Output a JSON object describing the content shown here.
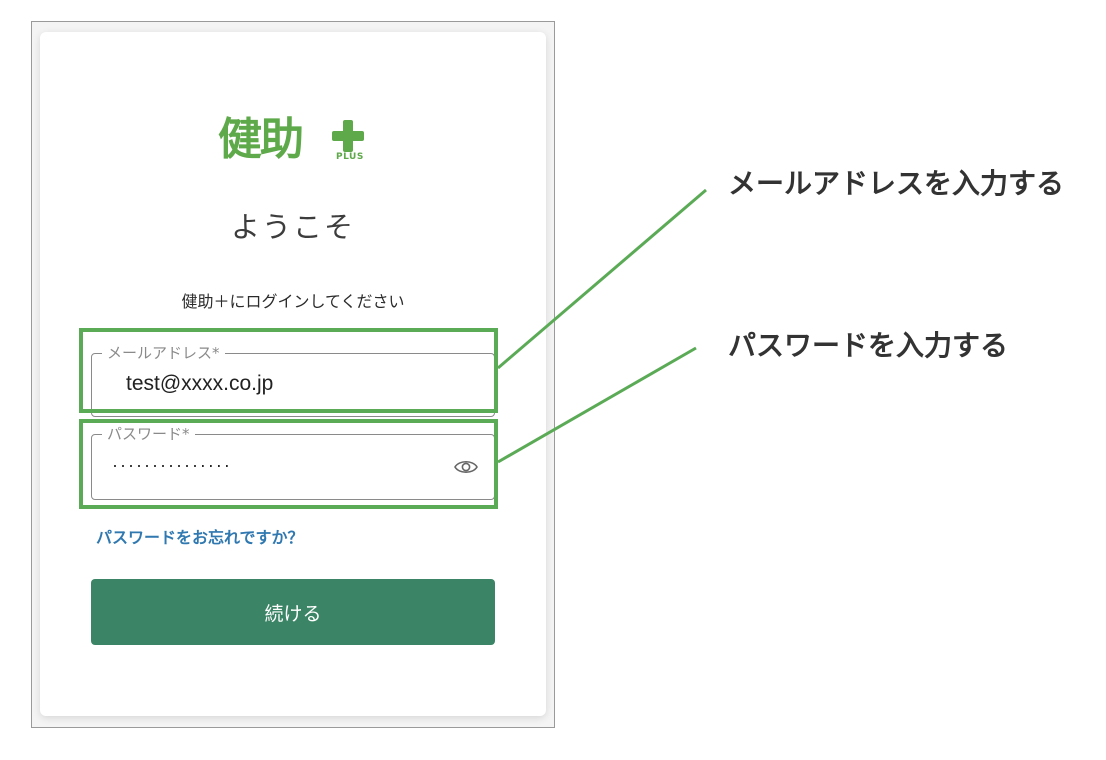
{
  "logo": {
    "text": "健助",
    "sub": "PLUS"
  },
  "welcome": "ようこそ",
  "instruction": "健助＋にログインしてください",
  "email_field": {
    "label": "メールアドレス*",
    "value": "test@xxxx.co.jp"
  },
  "password_field": {
    "label": "パスワード*",
    "value": "···············",
    "icon": "eye-icon"
  },
  "forgot_link": "パスワードをお忘れですか？",
  "continue_button": "続ける",
  "callouts": {
    "email": "メールアドレスを入力する",
    "password": "パスワードを入力する"
  },
  "colors": {
    "brand_green": "#5ea94a",
    "button_green": "#3b8566",
    "highlight_green": "#5aaa56",
    "link_blue": "#2f78b0"
  }
}
